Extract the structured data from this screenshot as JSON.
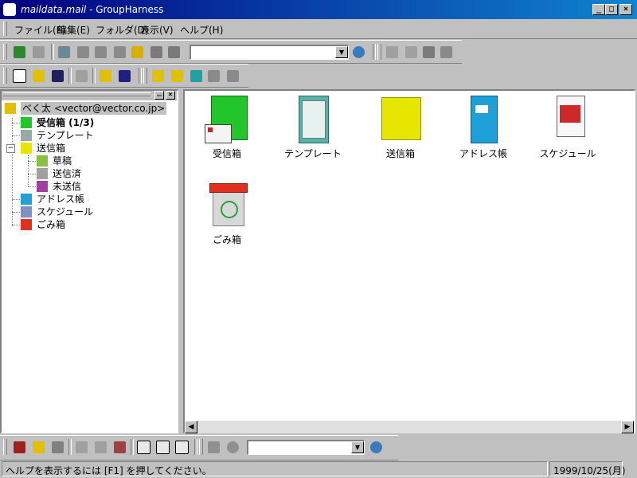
{
  "window": {
    "title_file": "maildata.mail",
    "title_sep": " - ",
    "title_app": "GroupHarness",
    "minimize": "_",
    "maximize": "□",
    "close": "×"
  },
  "menu": [
    {
      "label": "ファイル(F)"
    },
    {
      "label": "編集(E)"
    },
    {
      "label": "フォルダ(D)"
    },
    {
      "label": "表示(V)"
    },
    {
      "label": "ヘルプ(H)"
    }
  ],
  "toolbar1": {
    "combo_value": "",
    "icons": [
      "receive-mail-icon",
      "send-mail-icon",
      "new-mail-icon",
      "reply-icon",
      "reply-all-icon",
      "forward-icon",
      "move-icon",
      "delete-icon"
    ],
    "right_icons": [
      "search-icon",
      "cut-icon",
      "copy-icon",
      "paste-icon",
      "delete-icon"
    ]
  },
  "toolbar2": {
    "icons": [
      "new-icon",
      "open-icon",
      "save-icon",
      "print-icon",
      "help-icon",
      "context-help-icon",
      "new-folder-icon",
      "folder-move-icon",
      "address-icon",
      "folder-delete-icon",
      "folder-prop-icon"
    ]
  },
  "tree": {
    "root": "べく太 <vector@vector.co.jp>",
    "items": [
      {
        "label": "受信箱 (1/3)",
        "bold": true
      },
      {
        "label": "テンプレート"
      },
      {
        "label": "送信箱"
      },
      {
        "label": "草稿"
      },
      {
        "label": "送信済"
      },
      {
        "label": "未送信"
      },
      {
        "label": "アドレス帳"
      },
      {
        "label": "スケジュール"
      },
      {
        "label": "ごみ箱"
      }
    ],
    "expand_marker": "−"
  },
  "icons": [
    {
      "label": "受信箱",
      "color": "#22c52a"
    },
    {
      "label": "テンプレート",
      "color": "#58b2a6"
    },
    {
      "label": "送信箱",
      "color": "#e6e600"
    },
    {
      "label": "アドレス帳",
      "color": "#1da1d8"
    },
    {
      "label": "スケジュール",
      "color": "#cc2a2a"
    },
    {
      "label": "ごみ箱",
      "color": "#e03020"
    }
  ],
  "bottom_toolbar": {
    "combo_value": ""
  },
  "status": {
    "hint": "ヘルプを表示するには [F1] を押してください。",
    "date": "1999/10/25(月)"
  }
}
